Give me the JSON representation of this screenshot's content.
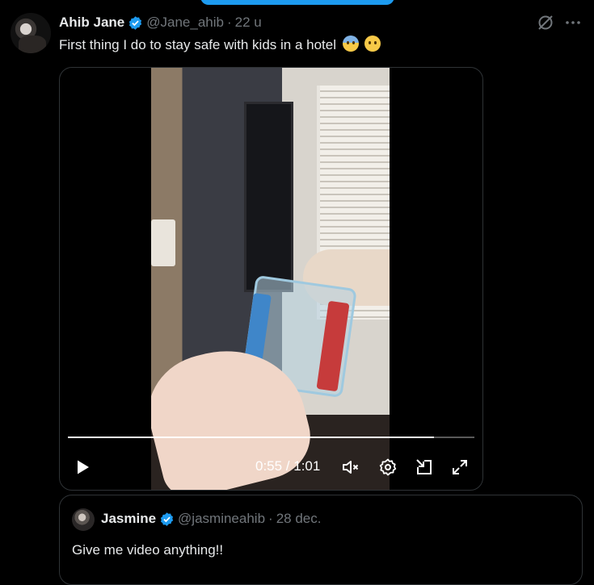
{
  "tweet": {
    "author_name": "Ahib Jane",
    "handle": "@Jane_ahib",
    "separator": "·",
    "time": "22 u",
    "text": "First thing I do to stay safe with kids in a hotel",
    "emojis": [
      "anxious-face",
      "pleading-face"
    ]
  },
  "video": {
    "current_time": "0:55",
    "duration": "1:01",
    "time_display": "0:55 / 1:01",
    "progress": 0.9
  },
  "quote": {
    "author_name": "Jasmine",
    "handle": "@jasmineahib",
    "separator": "·",
    "time": "28 dec.",
    "text": "Give me video anything!!"
  },
  "colors": {
    "background": "#000000",
    "text": "#e7e9ea",
    "secondary": "#71767b",
    "accent": "#1d9bf0",
    "border": "#2f3336"
  },
  "icons": [
    "grok-icon",
    "more-icon",
    "verified-badge-icon",
    "play-icon",
    "volume-mute-icon",
    "gear-icon",
    "pip-icon",
    "expand-icon"
  ]
}
